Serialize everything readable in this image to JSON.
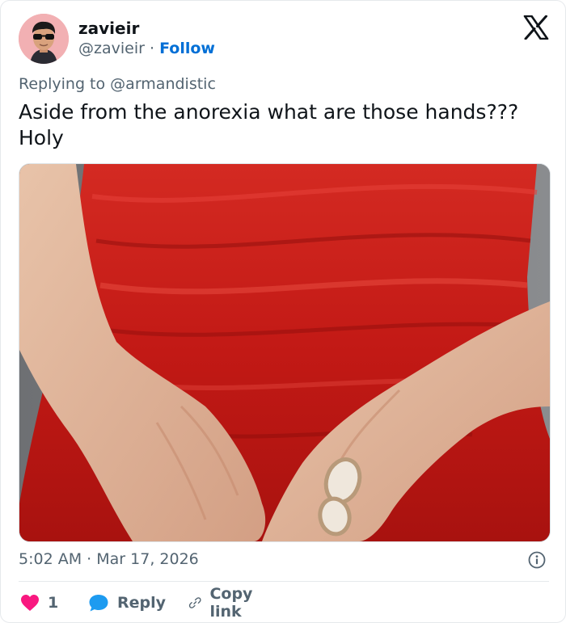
{
  "user": {
    "display_name": "zavieir",
    "handle": "@zavieir",
    "separator": "·",
    "follow_label": "Follow"
  },
  "reply": {
    "prefix": "Replying to",
    "target": "@armandistic"
  },
  "tweet": {
    "text": "Aside from the anorexia what are those hands???\nHoly"
  },
  "meta": {
    "time": "5:02 AM",
    "separator": "·",
    "date": "Mar 17, 2026"
  },
  "actions": {
    "like_count": "1",
    "reply_label": "Reply",
    "copy_label": "Copy link"
  },
  "icons": {
    "logo": "x-logo-icon",
    "info": "info-icon",
    "like": "heart-icon",
    "reply": "speech-bubble-icon",
    "copy": "link-icon"
  },
  "colors": {
    "follow": "#006fd6",
    "heart": "#f91880",
    "reply_bubble": "#1d9bf0",
    "muted": "#536471",
    "dress_red": "#c61b16"
  }
}
